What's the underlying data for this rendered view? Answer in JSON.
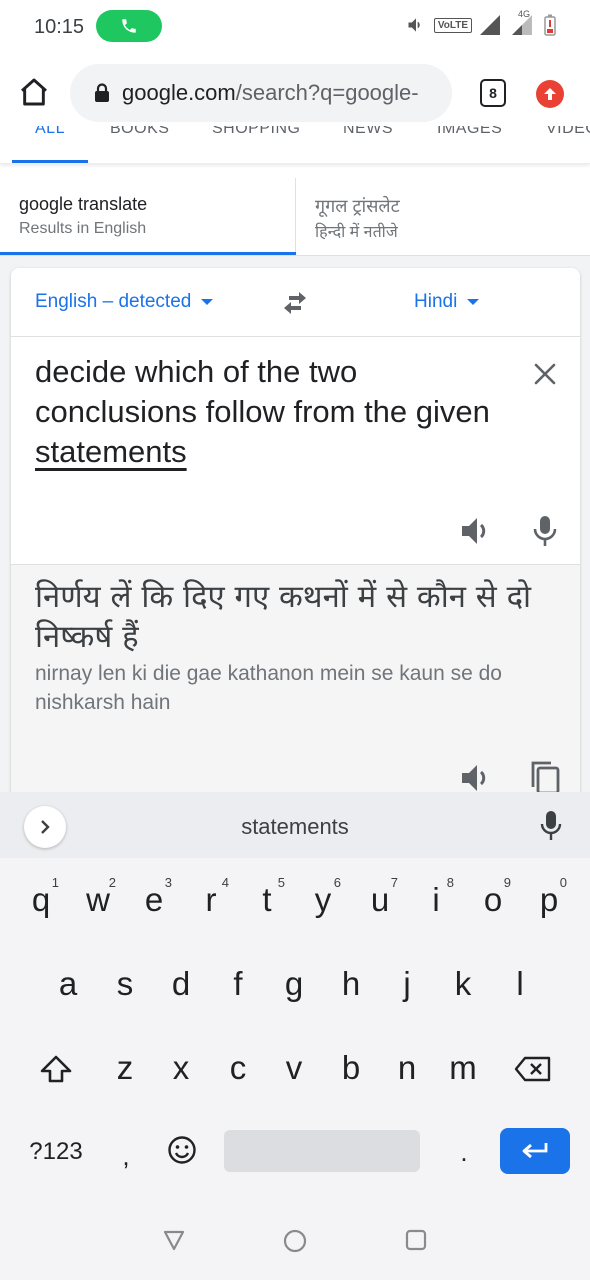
{
  "status_bar": {
    "time": "10:15",
    "volte_label": "VoLTE",
    "network_label": "4G"
  },
  "browser": {
    "url_domain": "google.com",
    "url_path": "/search?q=google-",
    "tab_count": "8"
  },
  "search_tabs": [
    "ALL",
    "BOOKS",
    "SHOPPING",
    "NEWS",
    "IMAGES",
    "VIDEOS"
  ],
  "result_tabs": [
    {
      "title": "google translate",
      "subtitle": "Results in English"
    },
    {
      "title": "गूगल ट्रांसलेट",
      "subtitle": "हिन्दी में नतीजे"
    }
  ],
  "translator": {
    "source_lang": "English – detected",
    "target_lang": "Hindi",
    "source_text_main": "decide which of the two conclusions follow from the given ",
    "source_text_underlined": "statements",
    "result_text": "निर्णय लें कि दिए गए कथनों में से कौन से दो निष्कर्ष हैं",
    "transliteration": "nirnay len ki die gae kathanon mein se kaun se do nishkarsh hain"
  },
  "keyboard": {
    "suggestion": "statements",
    "row1": [
      {
        "letter": "q",
        "num": "1"
      },
      {
        "letter": "w",
        "num": "2"
      },
      {
        "letter": "e",
        "num": "3"
      },
      {
        "letter": "r",
        "num": "4"
      },
      {
        "letter": "t",
        "num": "5"
      },
      {
        "letter": "y",
        "num": "6"
      },
      {
        "letter": "u",
        "num": "7"
      },
      {
        "letter": "i",
        "num": "8"
      },
      {
        "letter": "o",
        "num": "9"
      },
      {
        "letter": "p",
        "num": "0"
      }
    ],
    "row2": [
      "a",
      "s",
      "d",
      "f",
      "g",
      "h",
      "j",
      "k",
      "l"
    ],
    "row3": [
      "z",
      "x",
      "c",
      "v",
      "b",
      "n",
      "m"
    ],
    "symbols_label": "?123",
    "comma": ",",
    "period": "."
  },
  "colors": {
    "accent": "#1a73e8",
    "call_pill": "#1ec760",
    "update_badge": "#e94235"
  }
}
